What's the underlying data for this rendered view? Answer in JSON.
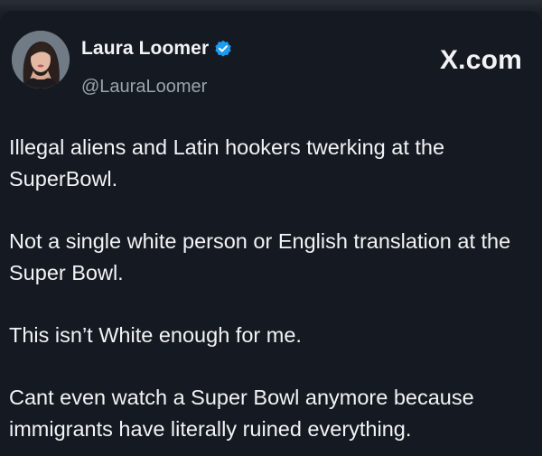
{
  "post": {
    "display_name": "Laura Loomer",
    "handle": "@LauraLoomer",
    "site": "X.com",
    "verified_color": "#1d9bf0",
    "paragraphs": [
      "Illegal aliens and Latin hookers twerking at the SuperBowl.",
      "Not a single white person or English translation at the Super Bowl.",
      "This isn’t White enough for me.",
      "Cant even watch a Super Bowl anymore because immigrants have literally ruined everything."
    ]
  }
}
